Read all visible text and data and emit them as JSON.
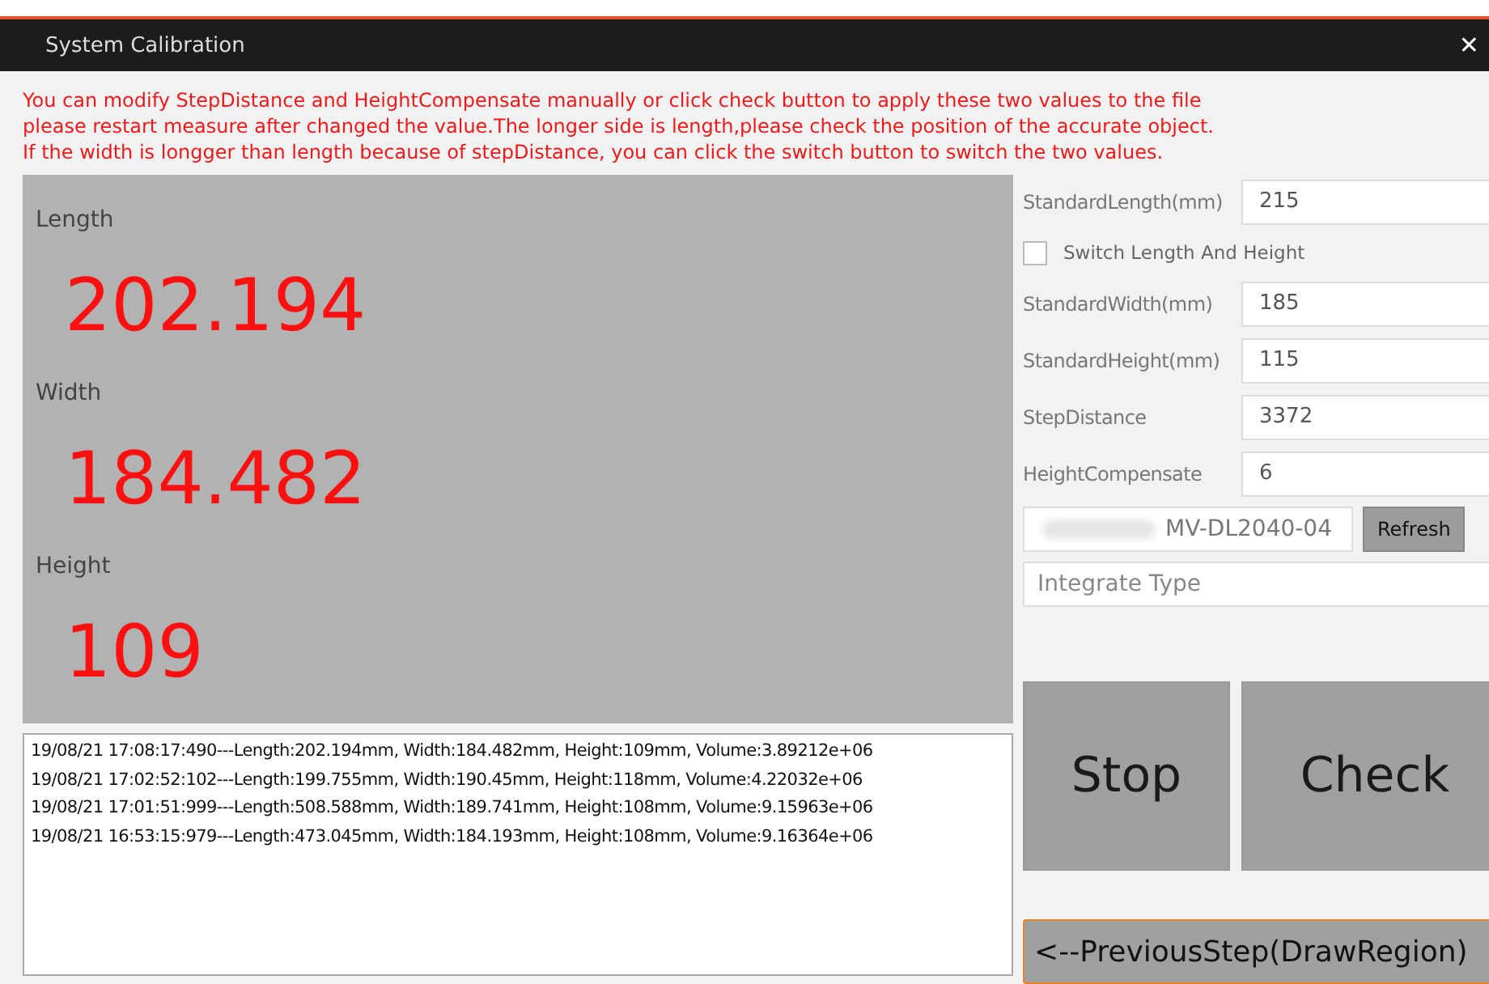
{
  "window": {
    "title": "System Calibration",
    "close": "✕"
  },
  "instructions": [
    "You can modify StepDistance and HeightCompensate manually or click check button to apply these two values to the file",
    "please restart measure after changed the value.The longer side is length,please check the position of the accurate object.",
    "If the width is longger than length because of stepDistance, you can click the switch button to switch the two values."
  ],
  "readings": [
    {
      "label": "Length",
      "value": "202.194"
    },
    {
      "label": "Width",
      "value": "184.482"
    },
    {
      "label": "Height",
      "value": "109"
    }
  ],
  "log": [
    "19/08/21 17:08:17:490---Length:202.194mm, Width:184.482mm, Height:109mm, Volume:3.89212e+06",
    "19/08/21 17:02:52:102---Length:199.755mm, Width:190.45mm, Height:118mm, Volume:4.22032e+06",
    "19/08/21 17:01:51:999---Length:508.588mm, Width:189.741mm, Height:108mm, Volume:9.15963e+06",
    "19/08/21 16:53:15:979---Length:473.045mm, Width:184.193mm, Height:108mm, Volume:9.16364e+06"
  ],
  "settings": [
    {
      "kind": "field",
      "label": "StandardLength(mm)",
      "value": "215"
    },
    {
      "kind": "checkbox",
      "label": "Switch Length And Height",
      "checked": false
    },
    {
      "kind": "field",
      "label": "StandardWidth(mm)",
      "value": "185"
    },
    {
      "kind": "field",
      "label": "StandardHeight(mm)",
      "value": "115"
    },
    {
      "kind": "field",
      "label": "StepDistance",
      "value": "3372"
    },
    {
      "kind": "spin",
      "label": "HeightCompensate",
      "value": "6"
    }
  ],
  "device": {
    "value": "MV-DL2040-04",
    "refresh": "Refresh"
  },
  "integrate_type": {
    "value": "Integrate Type"
  },
  "actions": [
    "Stop",
    "Check"
  ],
  "previous": "<--PreviousStep(DrawRegion)"
}
